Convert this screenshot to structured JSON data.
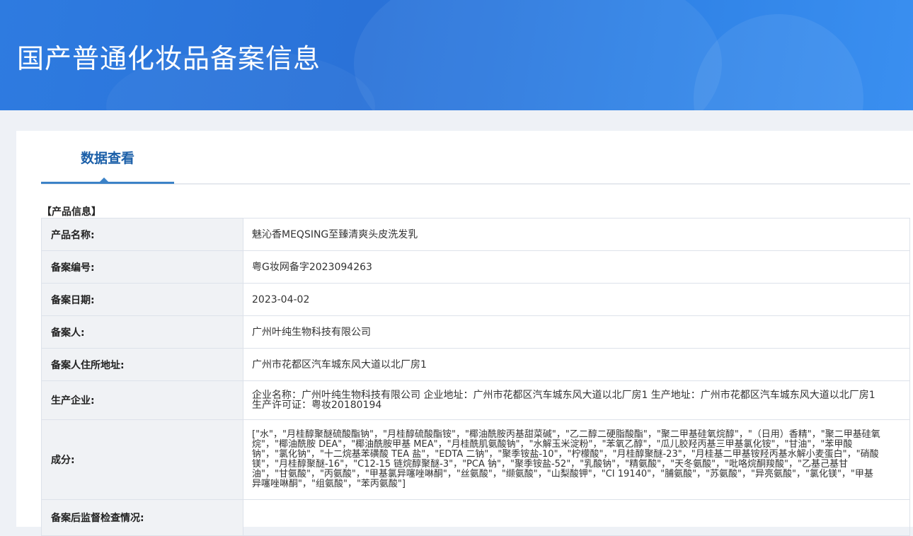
{
  "header": {
    "title": "国产普通化妆品备案信息"
  },
  "tabs": {
    "active": "数据查看"
  },
  "section": {
    "title": "【产品信息】"
  },
  "rows": [
    {
      "label": "产品名称:",
      "value": "魅沁香MEQSING至臻清爽头皮洗发乳"
    },
    {
      "label": "备案编号:",
      "value": "粤G妆网备字2023094263"
    },
    {
      "label": "备案日期:",
      "value": "2023-04-02"
    },
    {
      "label": "备案人:",
      "value": "广州叶纯生物科技有限公司"
    },
    {
      "label": "备案人住所地址:",
      "value": "广州市花都区汽车城东风大道以北厂房1"
    },
    {
      "label": "生产企业:",
      "value": "企业名称：广州叶纯生物科技有限公司 企业地址：广州市花都区汽车城东风大道以北厂房1 生产地址：广州市花都区汽车城东风大道以北厂房1 生产许可证：粤妆20180194"
    },
    {
      "label": "成分:",
      "value": "[\"水\"，\"月桂醇聚醚硫酸酯钠\"，\"月桂醇硫酸酯铵\"，\"椰油酰胺丙基甜菜碱\"，\"乙二醇二硬脂酸酯\"，\"聚二甲基硅氧烷醇\"，\"（日用）香精\"，\"聚二甲基硅氧烷\"，\"椰油酰胺 DEA\"，\"椰油酰胺甲基 MEA\"，\"月桂酰肌氨酸钠\"，\"水解玉米淀粉\"，\"苯氧乙醇\"，\"瓜儿胶羟丙基三甲基氯化铵\"，\"甘油\"，\"苯甲酸钠\"，\"氯化钠\"，\"十二烷基苯磺酸 TEA 盐\"，\"EDTA 二钠\"，\"聚季铵盐-10\"，\"柠檬酸\"，\"月桂醇聚醚-23\"，\"月桂基二甲基铵羟丙基水解小麦蛋白\"，\"硝酸镁\"，\"月桂醇聚醚-16\"，\"C12-15 链烷醇聚醚-3\"，\"PCA 钠\"，\"聚季铵盐-52\"，\"乳酸钠\"，\"精氨酸\"，\"天冬氨酸\"，\"吡咯烷酮羧酸\"，\"乙基己基甘油\"，\"甘氨酸\"，\"丙氨酸\"，\"甲基氯异噻唑啉酮\"，\"丝氨酸\"，\"缬氨酸\"，\"山梨酸钾\"，\"CI 19140\"，\"脯氨酸\"，\"苏氨酸\"，\"异亮氨酸\"，\"氯化镁\"，\"甲基异噻唑啉酮\"，\"组氨酸\"，\"苯丙氨酸\"]"
    },
    {
      "label": "备案后监督检查情况:",
      "value": ""
    }
  ]
}
